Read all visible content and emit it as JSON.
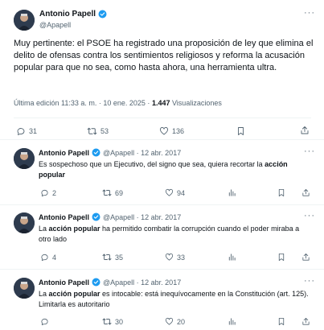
{
  "main_tweet": {
    "author_name": "Antonio Papell",
    "handle": "@Apapell",
    "text": "Muy pertinente: el PSOE ha registrado una proposición de ley que elimina el delito de ofensas contra los sentimientos religiosos y reforma la acusación popular para que no sea, como hasta ahora, una herramienta ultra.",
    "meta_prefix": "Última edición 11:33 a. m. · 10 ene. 2025 · ",
    "views_count": "1.447",
    "views_label": " Visualizaciones",
    "replies": "31",
    "retweets": "53",
    "likes": "136"
  },
  "replies": [
    {
      "author_name": "Antonio Papell",
      "handle_date": "@Apapell · 12 abr. 2017",
      "text_before": "Es sospechoso que un Ejecutivo, del signo que sea, quiera recortar la ",
      "text_bold": "acción popular",
      "text_after": "",
      "replies": "2",
      "retweets": "69",
      "likes": "94"
    },
    {
      "author_name": "Antonio Papell",
      "handle_date": "@Apapell · 12 abr. 2017",
      "text_before": "La ",
      "text_bold": "acción popular",
      "text_after": " ha permitido combatir la corrupción cuando el poder miraba a otro lado",
      "replies": "4",
      "retweets": "35",
      "likes": "33"
    },
    {
      "author_name": "Antonio Papell",
      "handle_date": "@Apapell · 12 abr. 2017",
      "text_before": "La ",
      "text_bold": "acción popular",
      "text_after": " es intocable: está inequívocamente en la Constitución (art. 125). Limitarla es autoritario",
      "replies": "",
      "retweets": "30",
      "likes": "20"
    }
  ],
  "colors": {
    "accent": "#1d9bf0",
    "text": "#0f1419",
    "secondary": "#536471",
    "divider": "#eff3f4"
  },
  "icons": {
    "more": "more-icon",
    "verified": "verified-badge-icon",
    "reply": "reply-icon",
    "retweet": "retweet-icon",
    "like": "like-icon",
    "views": "views-icon",
    "bookmark": "bookmark-icon",
    "share": "share-icon"
  },
  "more_glyph": "···"
}
